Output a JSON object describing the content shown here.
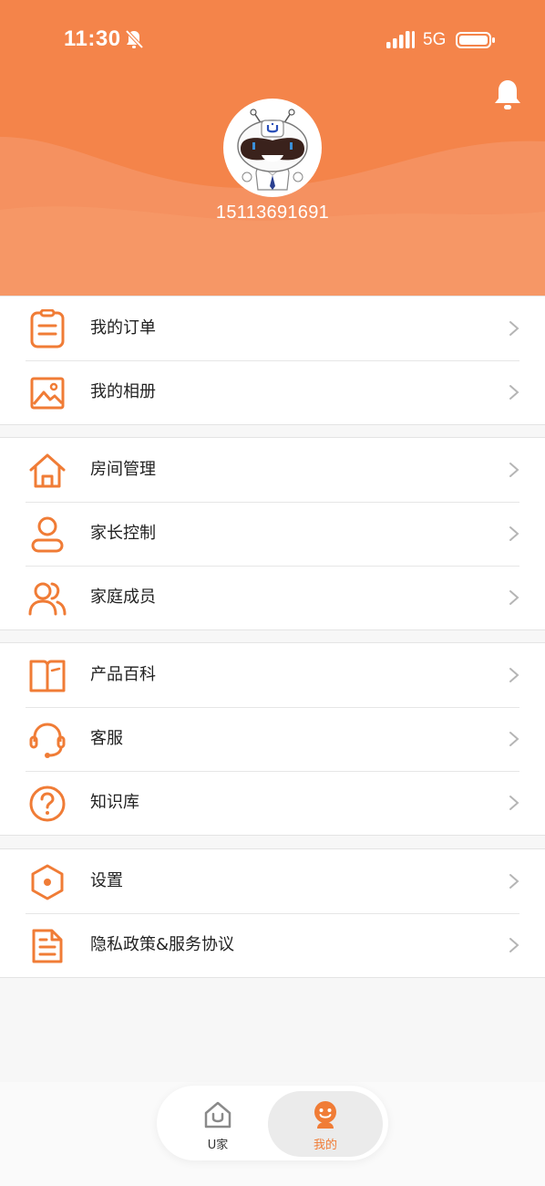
{
  "status_bar": {
    "time": "11:30",
    "network": "5G"
  },
  "profile": {
    "phone": "15113691691"
  },
  "menu_groups": [
    {
      "items": [
        {
          "label": "我的订单",
          "icon": "order-icon"
        },
        {
          "label": "我的相册",
          "icon": "photo-album-icon"
        }
      ]
    },
    {
      "items": [
        {
          "label": "房间管理",
          "icon": "house-icon"
        },
        {
          "label": "家长控制",
          "icon": "person-icon"
        },
        {
          "label": "家庭成员",
          "icon": "family-members-icon"
        }
      ]
    },
    {
      "items": [
        {
          "label": "产品百科",
          "icon": "book-icon"
        },
        {
          "label": "客服",
          "icon": "headset-icon"
        },
        {
          "label": "知识库",
          "icon": "question-icon"
        }
      ]
    },
    {
      "items": [
        {
          "label": "设置",
          "icon": "settings-hexagon-icon"
        },
        {
          "label": "隐私政策&服务协议",
          "icon": "document-icon"
        }
      ]
    }
  ],
  "tabbar": {
    "home_label": "U家",
    "mine_label": "我的",
    "active": "mine"
  },
  "colors": {
    "accent": "#f4844a",
    "accent_text": "#f07c36",
    "divider": "#e6e6e6"
  }
}
